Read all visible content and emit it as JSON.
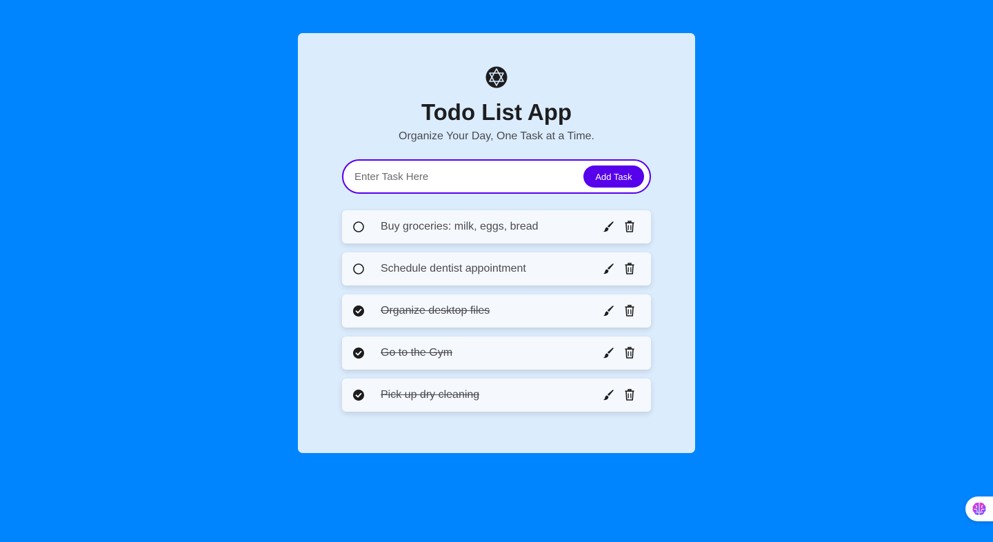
{
  "app": {
    "title": "Todo List App",
    "subtitle": "Organize Your Day, One Task at a Time.",
    "logo_icon": "polyhedron-logo-icon"
  },
  "input": {
    "placeholder": "Enter Task Here",
    "value": "",
    "add_label": "Add Task"
  },
  "tasks": [
    {
      "text": "Buy groceries: milk, eggs, bread",
      "completed": false
    },
    {
      "text": "Schedule dentist appointment",
      "completed": false
    },
    {
      "text": "Organize desktop files",
      "completed": true
    },
    {
      "text": "Go to the Gym",
      "completed": true
    },
    {
      "text": "Pick up dry cleaning",
      "completed": true
    }
  ],
  "icons": {
    "edit": "paintbrush-icon",
    "delete": "trash-icon",
    "incomplete": "circle-icon",
    "complete": "check-circle-icon",
    "assistant": "brain-icon"
  },
  "colors": {
    "background": "#0085ff",
    "card": "#dbecfd",
    "accent": "#5600eb",
    "task_bg": "#f5f9fd"
  }
}
